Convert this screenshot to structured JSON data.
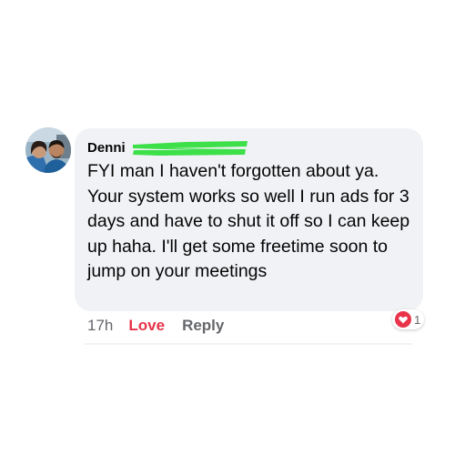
{
  "comment": {
    "author_name": "Denni",
    "text": "FYI man I haven't forgotten about ya. Your system works so well I run ads for 3 days and have to shut it off so I can keep up haha. I'll get some freetime soon to jump on your meetings",
    "timestamp": "17h",
    "love_label": "Love",
    "reply_label": "Reply",
    "reaction_count": "1",
    "reaction_icon": "heart-icon",
    "avatar_icon": "profile-photo"
  },
  "colors": {
    "bubble_background": "#f0f2f5",
    "text": "#050505",
    "muted_text": "#65676b",
    "love_accent": "#e8334a",
    "redaction_green": "#3ee04a"
  }
}
